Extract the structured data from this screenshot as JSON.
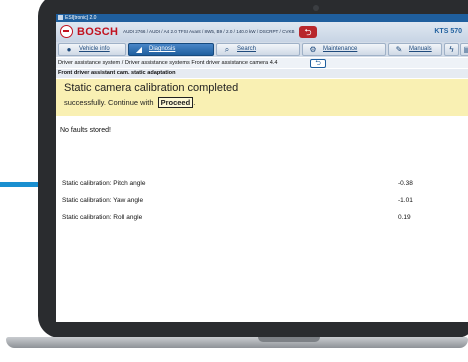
{
  "window": {
    "title": "ESI[tronic] 2.0"
  },
  "header": {
    "brand": "BOSCH",
    "vehicle_info": "AUDI 2766 / AUDI / A4 2.0 TFSI Avant / 8W5, B9 / 2.0 / 140.0 kW / DSCRPT / CVKB",
    "back_symbol": "⮌",
    "device": "KTS 570"
  },
  "tabs": [
    {
      "label": "Vehicle info",
      "icon": "vehicle-info-icon",
      "active": false
    },
    {
      "label": "Diagnosis",
      "icon": "diagnosis-icon",
      "active": true
    },
    {
      "label": "Search",
      "icon": "search-icon",
      "active": false
    },
    {
      "label": "Maintenance",
      "icon": "maintenance-icon",
      "active": false
    },
    {
      "label": "Manuals",
      "icon": "manuals-icon",
      "active": false
    }
  ],
  "breadcrumb": "Driver assistance system / Driver assistance systems Front driver assistance camera 4.4",
  "subtitle": "Front driver assistant cam. static adaptation",
  "banner": {
    "title": "Static camera calibration completed",
    "message": "successfully. Continue with",
    "proceed_label": "Proceed",
    "message_end": "."
  },
  "faults_text": "No faults stored!",
  "results": [
    {
      "label": "Static calibration: Pitch angle",
      "value": "-0.38"
    },
    {
      "label": "Static calibration: Yaw angle",
      "value": "-1.01"
    },
    {
      "label": "Static calibration: Roll angle",
      "value": "0.19"
    }
  ],
  "colors": {
    "bosch_red": "#c1121f",
    "active_tab": "#1f5f9e",
    "banner_bg": "#f9f0b3",
    "accent_line": "#1a8fd0"
  }
}
